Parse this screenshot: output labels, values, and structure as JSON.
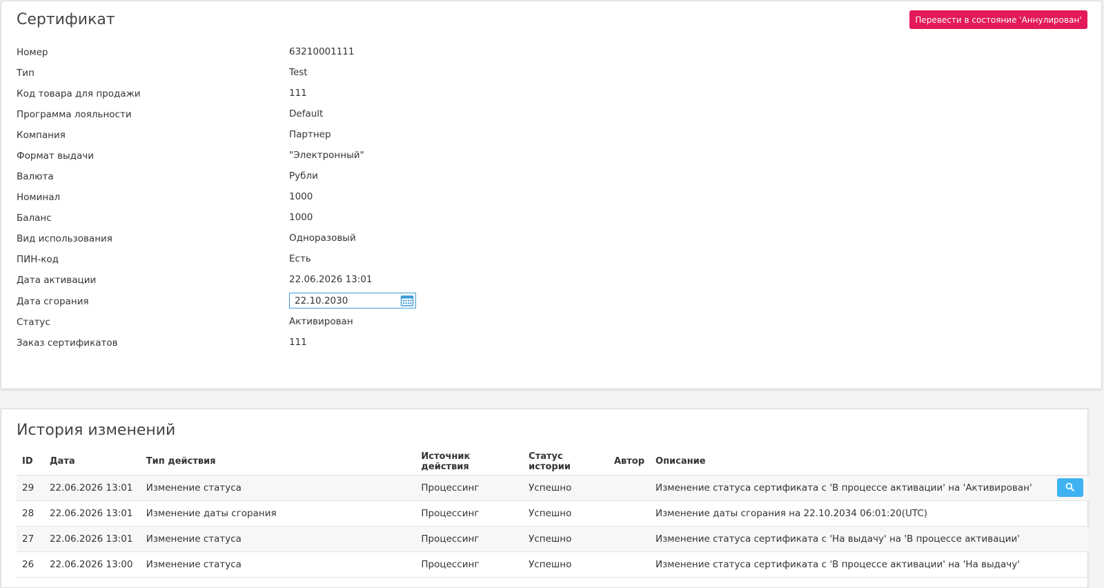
{
  "certificate": {
    "title": "Сертификат",
    "annul_button_label": "Перевести в состояние 'Аннулирован'",
    "fields": [
      {
        "label": "Номер",
        "value": "63210001111"
      },
      {
        "label": "Тип",
        "value": "Test"
      },
      {
        "label": "Код товара для продажи",
        "value": "111"
      },
      {
        "label": "Программа лояльности",
        "value": "Default"
      },
      {
        "label": "Компания",
        "value": "Партнер"
      },
      {
        "label": "Формат выдачи",
        "value": "\"Электронный\""
      },
      {
        "label": "Валюта",
        "value": "Рубли"
      },
      {
        "label": "Номинал",
        "value": "1000"
      },
      {
        "label": "Баланс",
        "value": "1000"
      },
      {
        "label": "Вид использования",
        "value": "Одноразовый"
      },
      {
        "label": "ПИН-код",
        "value": "Есть"
      },
      {
        "label": "Дата активации",
        "value": "22.06.2026 13:01"
      },
      {
        "label": "Дата сгорания",
        "value": "22.10.2030"
      },
      {
        "label": "Статус",
        "value": "Активирован"
      },
      {
        "label": "Заказ сертификатов",
        "value": "111"
      }
    ]
  },
  "history": {
    "title": "История изменений",
    "columns": [
      "ID",
      "Дата",
      "Тип действия",
      "Источник действия",
      "Статус истории",
      "Автор",
      "Описание"
    ],
    "rows": [
      {
        "id": "29",
        "date": "22.06.2026 13:01",
        "action": "Изменение статуса",
        "source": "Процессинг",
        "status": "Успешно",
        "author": "",
        "description": "Изменение статуса сертификата с 'В процессе активации' на 'Активирован'"
      },
      {
        "id": "28",
        "date": "22.06.2026 13:01",
        "action": "Изменение даты сгорания",
        "source": "Процессинг",
        "status": "Успешно",
        "author": "",
        "description": "Изменение даты сгорания на 22.10.2034 06:01:20(UTC)"
      },
      {
        "id": "27",
        "date": "22.06.2026 13:01",
        "action": "Изменение статуса",
        "source": "Процессинг",
        "status": "Успешно",
        "author": "",
        "description": "Изменение статуса сертификата с 'На выдачу' на 'В процессе активации'"
      },
      {
        "id": "26",
        "date": "22.06.2026 13:00",
        "action": "Изменение статуса",
        "source": "Процессинг",
        "status": "Успешно",
        "author": "",
        "description": "Изменение статуса сертификата с 'В процессе активации' на 'На выдачу'"
      }
    ]
  },
  "colors": {
    "annul_button": "#e3195a",
    "view_button": "#3fb3f2",
    "input_border": "#3a9ad9"
  },
  "icons": {
    "calendar": "calendar-icon",
    "view": "search-icon"
  }
}
